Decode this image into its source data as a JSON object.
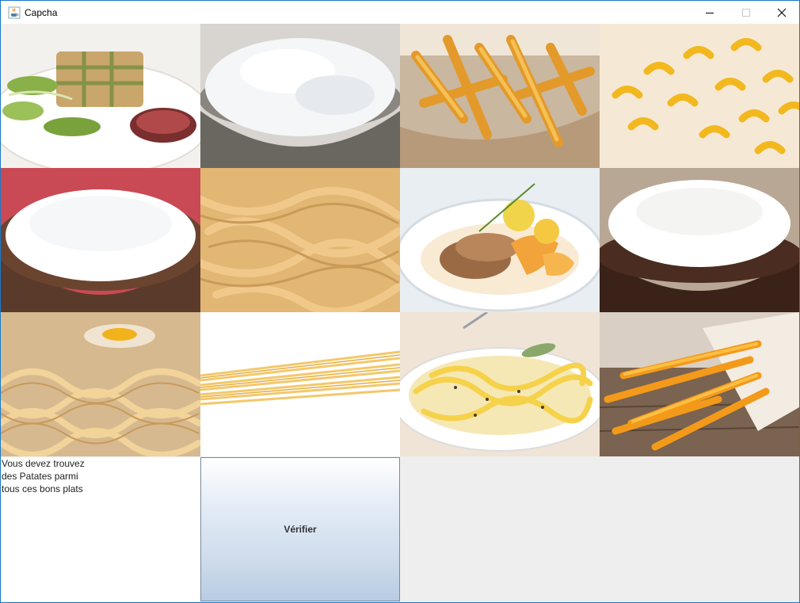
{
  "window": {
    "title": "Capcha",
    "icon": "java-cup-icon",
    "controls": [
      "minimize-icon",
      "maximize-icon",
      "close-icon"
    ]
  },
  "tiles": [
    {
      "name": "tile-meat-zucchini-wellington",
      "icon": "food-photo"
    },
    {
      "name": "tile-rice-bowl-grey",
      "icon": "food-photo"
    },
    {
      "name": "tile-fries-basket",
      "icon": "food-photo"
    },
    {
      "name": "tile-macaroni",
      "icon": "food-photo"
    },
    {
      "name": "tile-rice-bowl-wood",
      "icon": "food-photo"
    },
    {
      "name": "tile-tagliatelle",
      "icon": "food-photo"
    },
    {
      "name": "tile-chicken-peach",
      "icon": "food-photo"
    },
    {
      "name": "tile-rice-bowl-dark",
      "icon": "food-photo"
    },
    {
      "name": "tile-fresh-pasta-egg",
      "icon": "food-photo"
    },
    {
      "name": "tile-spaghetti-dry",
      "icon": "food-photo"
    },
    {
      "name": "tile-pasta-cream-plate",
      "icon": "food-photo"
    },
    {
      "name": "tile-fries-cone",
      "icon": "food-photo"
    }
  ],
  "instruction": {
    "line1": "Vous devez trouvez",
    "line2": "des Patates parmi",
    "line3": "tous ces bons plats"
  },
  "verify_button": {
    "label": "Vérifier"
  }
}
